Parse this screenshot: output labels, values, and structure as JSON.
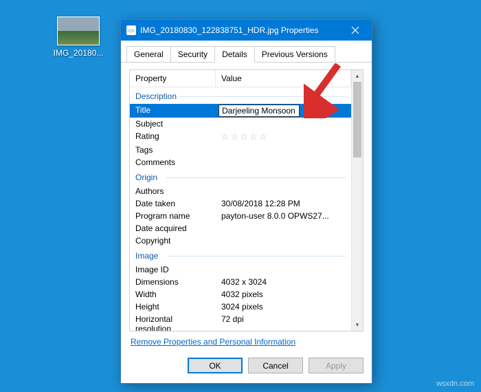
{
  "desktop": {
    "icon_label": "IMG_20180..."
  },
  "dialog": {
    "title": "IMG_20180830_122838751_HDR.jpg Properties",
    "tabs": [
      "General",
      "Security",
      "Details",
      "Previous Versions"
    ],
    "active_tab": "Details",
    "columns": {
      "property": "Property",
      "value": "Value"
    },
    "groups": [
      {
        "name": "Description",
        "rows": [
          {
            "prop": "Title",
            "value": "Darjeeling Monsoon",
            "editing": true,
            "selected": true
          },
          {
            "prop": "Subject",
            "value": ""
          },
          {
            "prop": "Rating",
            "value": "",
            "type": "rating"
          },
          {
            "prop": "Tags",
            "value": ""
          },
          {
            "prop": "Comments",
            "value": ""
          }
        ]
      },
      {
        "name": "Origin",
        "rows": [
          {
            "prop": "Authors",
            "value": ""
          },
          {
            "prop": "Date taken",
            "value": "30/08/2018 12:28 PM"
          },
          {
            "prop": "Program name",
            "value": "payton-user 8.0.0 OPWS27..."
          },
          {
            "prop": "Date acquired",
            "value": ""
          },
          {
            "prop": "Copyright",
            "value": ""
          }
        ]
      },
      {
        "name": "Image",
        "rows": [
          {
            "prop": "Image ID",
            "value": ""
          },
          {
            "prop": "Dimensions",
            "value": "4032 x 3024"
          },
          {
            "prop": "Width",
            "value": "4032 pixels"
          },
          {
            "prop": "Height",
            "value": "3024 pixels"
          },
          {
            "prop": "Horizontal resolution",
            "value": "72 dpi"
          }
        ]
      }
    ],
    "remove_link": "Remove Properties and Personal Information",
    "buttons": {
      "ok": "OK",
      "cancel": "Cancel",
      "apply": "Apply"
    }
  },
  "watermark": "wsxdn.com"
}
